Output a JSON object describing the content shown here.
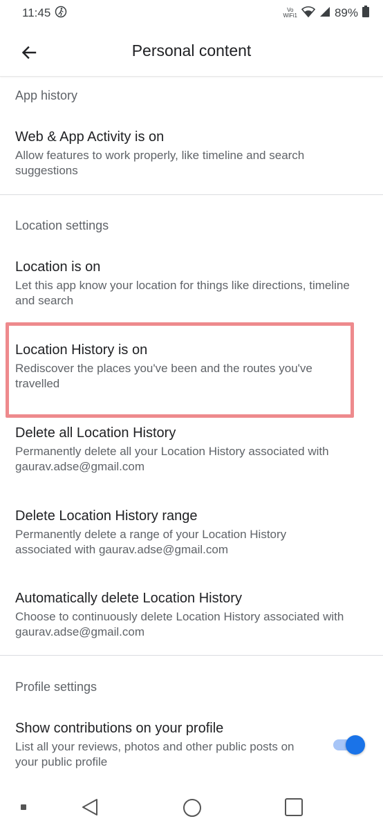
{
  "status": {
    "time": "11:45",
    "vowifi_top": "Vo",
    "vowifi_bottom": "WiFi1",
    "battery": "89%"
  },
  "app_bar": {
    "title": "Personal content"
  },
  "sections": {
    "app_history": {
      "header": "App history",
      "items": [
        {
          "title": "Web & App Activity is on",
          "description": "Allow features to work properly, like timeline and search suggestions"
        }
      ]
    },
    "location_settings": {
      "header": "Location settings",
      "items": [
        {
          "title": "Location is on",
          "description": "Let this app know your location for things like directions, timeline and search"
        },
        {
          "title": "Location History is on",
          "description": "Rediscover the places you've been and the routes you've travelled"
        },
        {
          "title": "Delete all Location History",
          "description": "Permanently delete all your Location History associated with gaurav.adse@gmail.com"
        },
        {
          "title": "Delete Location History range",
          "description": "Permanently delete a range of your Location History associated with gaurav.adse@gmail.com"
        },
        {
          "title": "Automatically delete Location History",
          "description": "Choose to continuously delete Location History associated with gaurav.adse@gmail.com"
        }
      ]
    },
    "profile_settings": {
      "header": "Profile settings",
      "items": [
        {
          "title": "Show contributions on your profile",
          "description": "List all your reviews, photos and other public posts on your public profile",
          "toggle_on": true
        }
      ]
    }
  },
  "colors": {
    "accent": "#1a73e8",
    "highlight_border": "#ee8a8d"
  }
}
